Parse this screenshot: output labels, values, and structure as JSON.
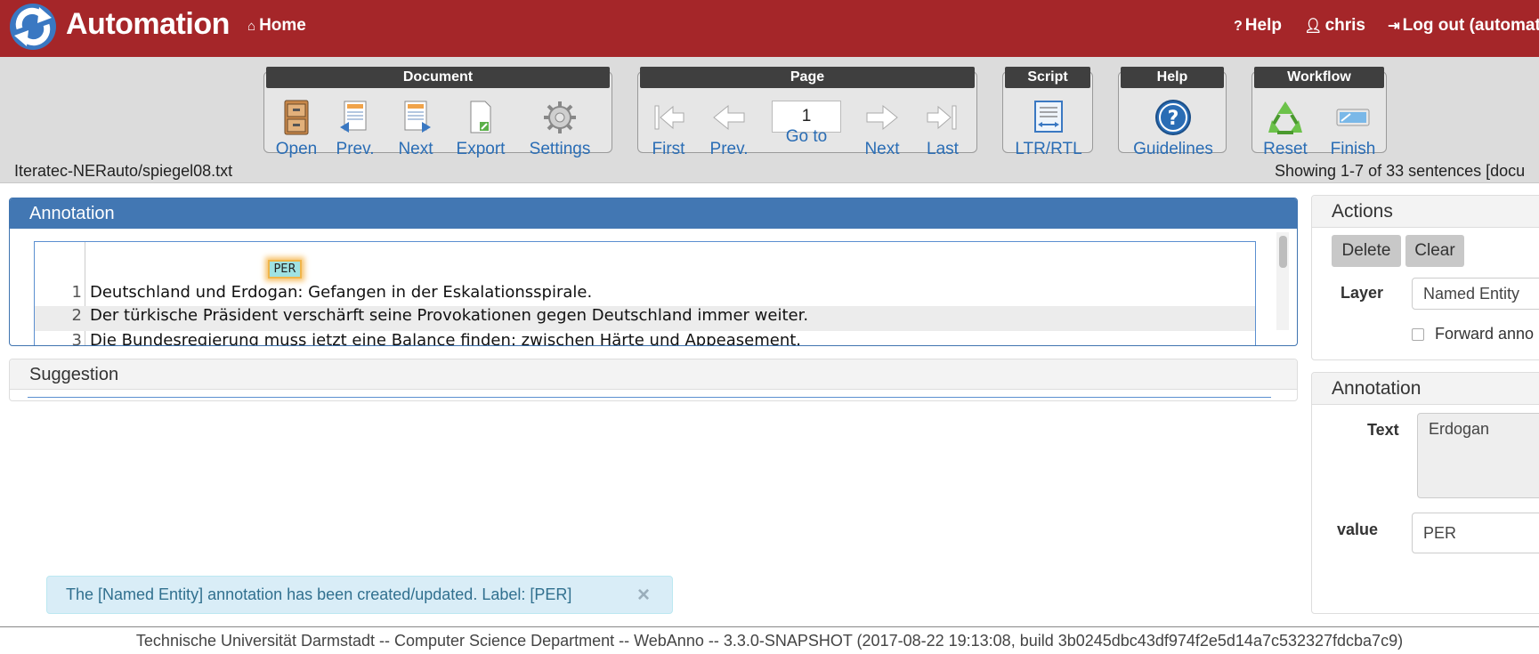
{
  "header": {
    "app_title": "Automation",
    "home": "Home",
    "help": "Help",
    "user": "chris",
    "logout": "Log out (automatica"
  },
  "toolbar": {
    "document": {
      "title": "Document",
      "open": "Open",
      "prev": "Prev.",
      "next": "Next",
      "export": "Export",
      "settings": "Settings"
    },
    "page": {
      "title": "Page",
      "first": "First",
      "prev": "Prev.",
      "page_number": "1",
      "goto": "Go to",
      "next": "Next",
      "last": "Last"
    },
    "script": {
      "title": "Script",
      "ltr_rtl": "LTR/RTL"
    },
    "help": {
      "title": "Help",
      "guidelines": "Guidelines"
    },
    "workflow": {
      "title": "Workflow",
      "reset": "Reset",
      "finish": "Finish"
    }
  },
  "document_path": "Iteratec-NERauto/spiegel08.txt",
  "showing_text": "Showing 1-7 of 33 sentences [docu",
  "annotation_panel": {
    "title": "Annotation",
    "span_label": "PER",
    "sentences": [
      {
        "num": "1",
        "text": "Deutschland und Erdogan: Gefangen in der Eskalationsspirale."
      },
      {
        "num": "2",
        "text": "Der türkische Präsident verschärft seine Provokationen gegen Deutschland immer weiter."
      },
      {
        "num": "3",
        "text": "Die Bundesregierung muss jetzt eine Balance finden: zwischen Härte und Appeasement."
      }
    ]
  },
  "suggestion_panel": {
    "title": "Suggestion"
  },
  "actions_panel": {
    "title": "Actions",
    "delete": "Delete",
    "clear": "Clear",
    "layer_label": "Layer",
    "layer_value": "Named Entity",
    "forward_label": "Forward anno"
  },
  "annotation_detail": {
    "title": "Annotation",
    "text_label": "Text",
    "text_value": "Erdogan",
    "value_label": "value",
    "value_value": "PER"
  },
  "alert": {
    "message": "The [Named Entity] annotation has been created/updated. Label: [PER]",
    "close": "×"
  },
  "footer": "Technische Universität Darmstadt -- Computer Science Department -- WebAnno -- 3.3.0-SNAPSHOT (2017-08-22 19:13:08, build 3b0245dbc43df974f2e5d14a7c532327fdcba7c9)",
  "colors": {
    "header_bg": "#a52629",
    "panel_blue": "#4277b3",
    "link_blue": "#2a6db5",
    "per_tag": "#9fe2e2",
    "alert_bg": "#d9edf7"
  }
}
